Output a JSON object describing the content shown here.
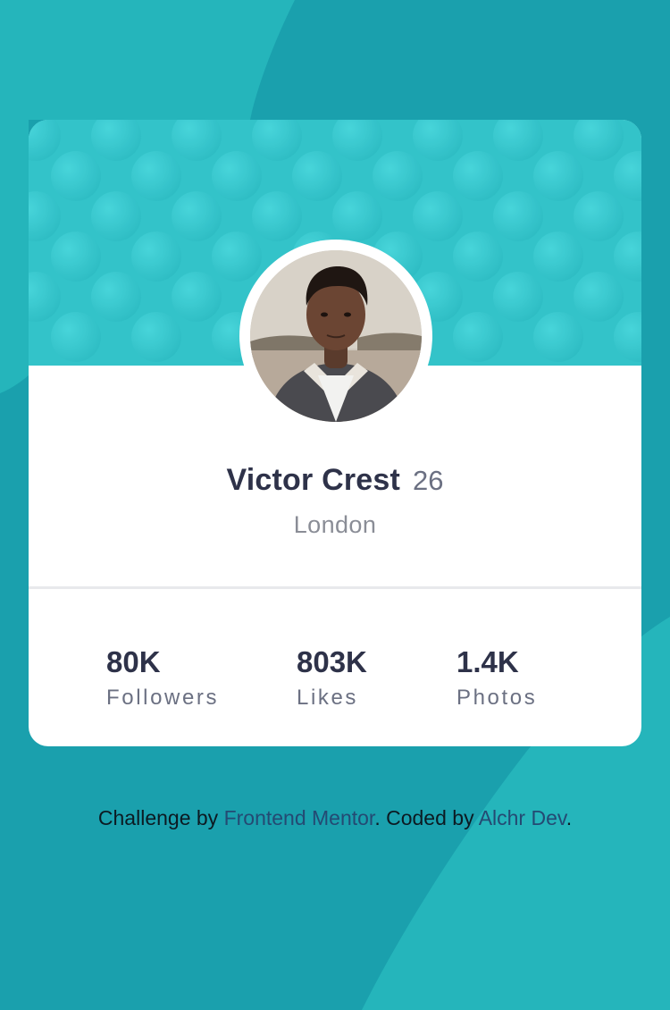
{
  "colors": {
    "background": "#1aa0ad",
    "header": "#35c6cc",
    "text_dark": "#2e3249",
    "text_muted": "#6b7082",
    "link": "#244a73"
  },
  "profile": {
    "name": "Victor Crest",
    "age": "26",
    "city": "London",
    "avatar_icon": "profile-photo"
  },
  "stats": [
    {
      "value": "80K",
      "label": "Followers"
    },
    {
      "value": "803K",
      "label": "Likes"
    },
    {
      "value": "1.4K",
      "label": "Photos"
    }
  ],
  "footer": {
    "prefix": "Challenge by ",
    "link1": "Frontend Mentor",
    "middle": ". Coded by ",
    "link2": "Alchr Dev",
    "suffix": "."
  }
}
